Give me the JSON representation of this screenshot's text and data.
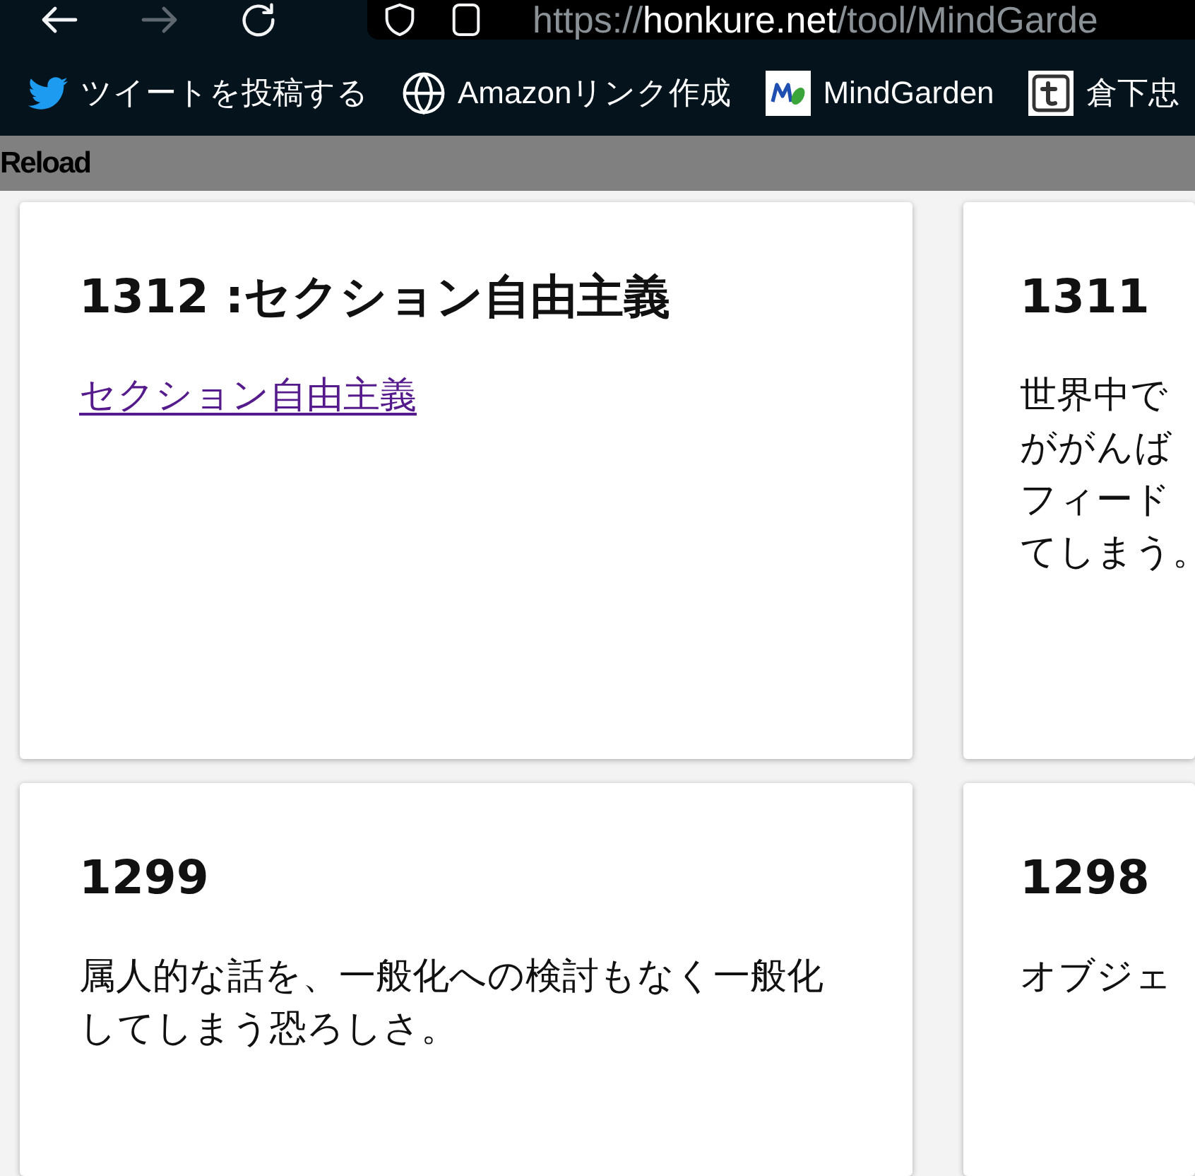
{
  "toolbar": {
    "buttons": [
      {
        "disabled": false
      },
      {
        "disabled": true
      },
      {
        "disabled": false
      }
    ],
    "address": {
      "scheme": "https://",
      "host": "honkure.net",
      "path": "/tool/MindGarde"
    }
  },
  "bookmarks": [
    {
      "label": "ツイートを投稿する"
    },
    {
      "label": "Amazonリンク作成"
    },
    {
      "label": "MindGarden"
    },
    {
      "label": "倉下忠"
    }
  ],
  "header": {
    "reload_label": "Reload"
  },
  "cards": [
    {
      "title": "1312 :セクション自由主義",
      "kind": "link",
      "link": "セクション自由主義",
      "visited": true
    },
    {
      "title": "1311",
      "kind": "text",
      "lines": [
        "世界中で",
        "ががんば",
        "フィード",
        "てしまう。"
      ]
    },
    {
      "title": "1299",
      "kind": "text",
      "lines": [
        "属人的な話を、一般化への検討もなく一般化",
        "してしまう恐ろしさ。"
      ]
    },
    {
      "title": "1298",
      "kind": "text",
      "lines": [
        "オブジェ"
      ]
    }
  ]
}
